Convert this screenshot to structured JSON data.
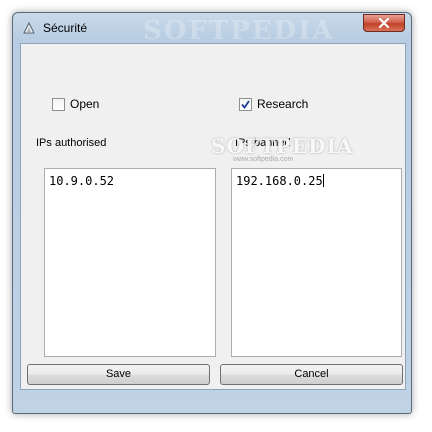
{
  "window": {
    "title": "Sécurité",
    "watermark": "SOFTPEDIA"
  },
  "checkboxes": {
    "open": {
      "label": "Open",
      "checked": false
    },
    "research": {
      "label": "Research",
      "checked": true
    }
  },
  "fields": {
    "authorised": {
      "label": "IPs authorised",
      "value": "10.9.0.52"
    },
    "banned": {
      "label": "IPs banned",
      "value": "192.168.0.25"
    }
  },
  "buttons": {
    "save": "Save",
    "cancel": "Cancel"
  },
  "overlay": {
    "watermark": "SOFTPEDIA",
    "watermark_sub": "www.softpedia.com"
  },
  "colors": {
    "frame": "#bfd2e6",
    "client": "#f0f0f0",
    "close": "#c2412a"
  },
  "icons": [
    "shield-icon",
    "close-icon",
    "checkmark-icon"
  ]
}
